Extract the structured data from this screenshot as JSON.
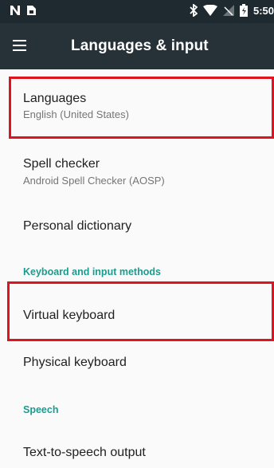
{
  "status_bar": {
    "left_icons": [
      "n-notification-icon",
      "sim-icon"
    ],
    "right_icons": [
      "bluetooth-icon",
      "wifi-icon",
      "no-signal-icon",
      "battery-icon"
    ],
    "time": "5:50"
  },
  "toolbar": {
    "title": "Languages & input"
  },
  "items": {
    "languages": {
      "title": "Languages",
      "summary": "English (United States)"
    },
    "spell_checker": {
      "title": "Spell checker",
      "summary": "Android Spell Checker (AOSP)"
    },
    "personal_dictionary": {
      "title": "Personal dictionary"
    },
    "keyboard_category": "Keyboard and input methods",
    "virtual_keyboard": {
      "title": "Virtual keyboard"
    },
    "physical_keyboard": {
      "title": "Physical keyboard"
    },
    "speech_category": "Speech",
    "tts_output": {
      "title": "Text-to-speech output"
    }
  },
  "colors": {
    "status_bar": "#1f2a30",
    "toolbar": "#263238",
    "accent": "#1a9c8e",
    "highlight": "#e0141e"
  }
}
